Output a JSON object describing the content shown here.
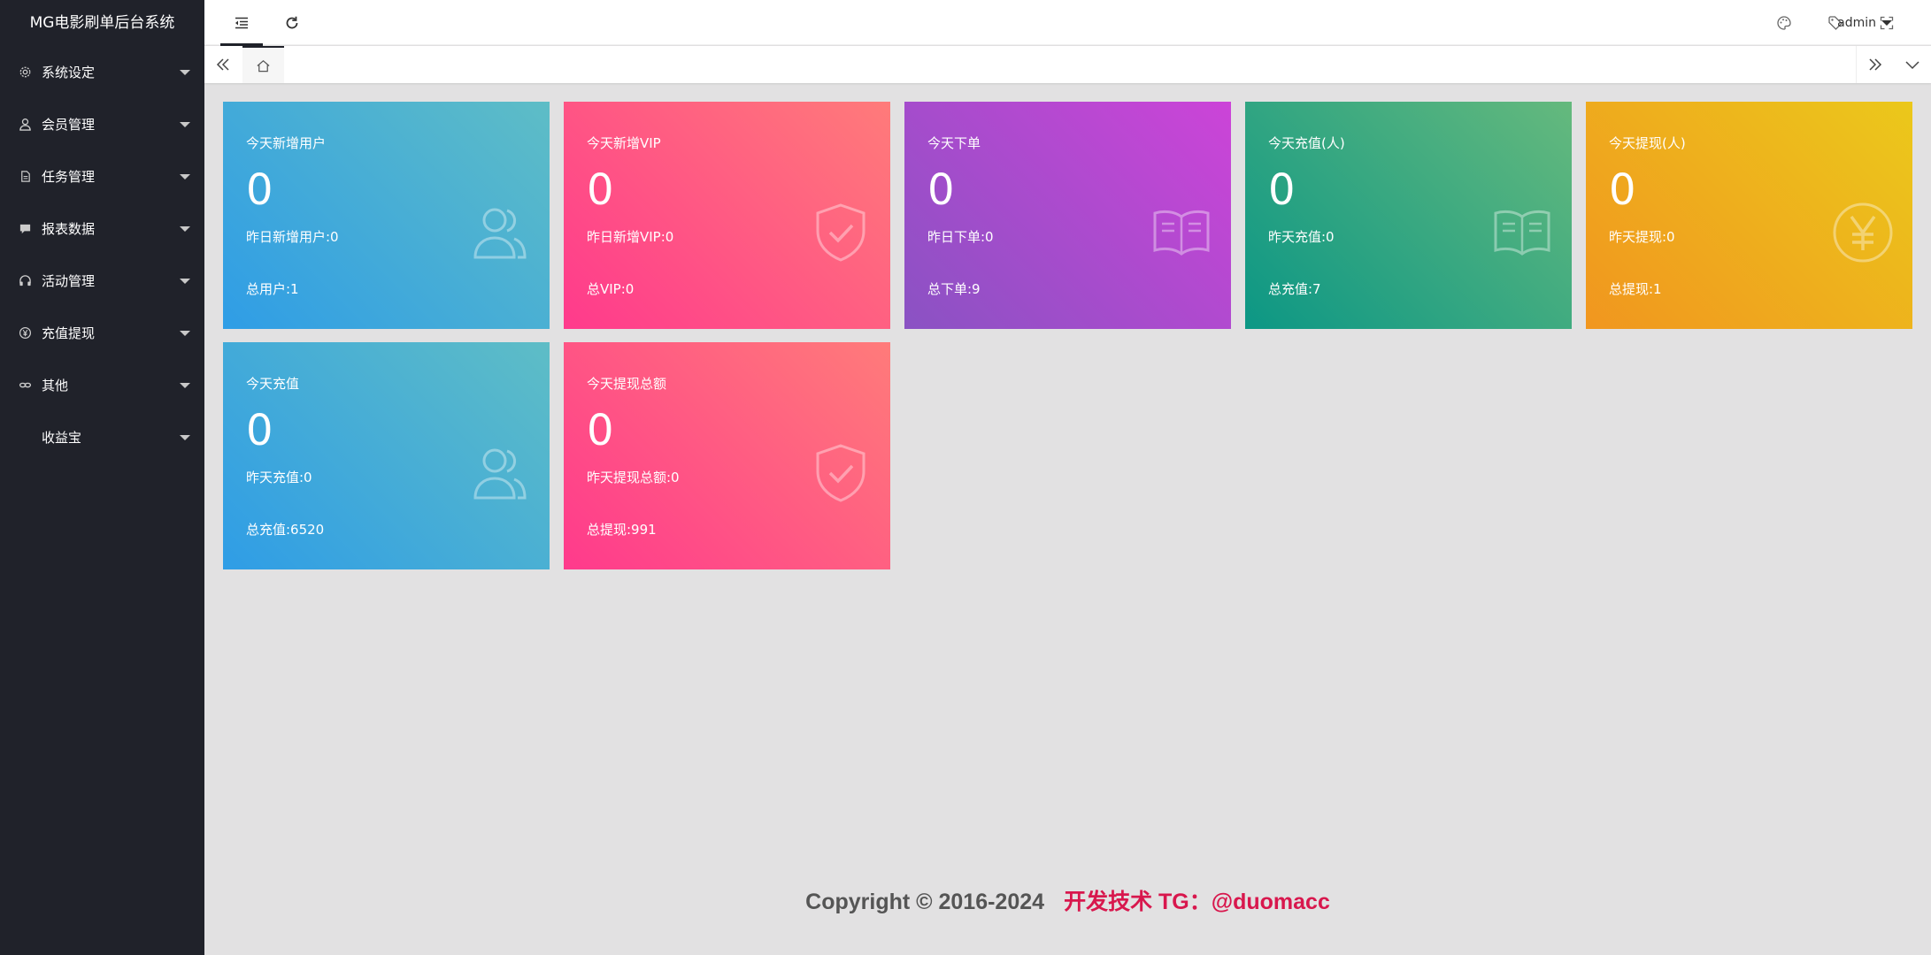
{
  "app": {
    "title": "MG电影刷单后台系统"
  },
  "sidebar": {
    "items": [
      {
        "label": "系统设定",
        "icon": "gear-icon"
      },
      {
        "label": "会员管理",
        "icon": "user-icon"
      },
      {
        "label": "任务管理",
        "icon": "document-icon"
      },
      {
        "label": "报表数据",
        "icon": "chat-icon"
      },
      {
        "label": "活动管理",
        "icon": "headset-icon"
      },
      {
        "label": "充值提现",
        "icon": "yen-circle-icon"
      },
      {
        "label": "其他",
        "icon": "link-icon"
      },
      {
        "label": "收益宝",
        "icon": ""
      }
    ]
  },
  "header": {
    "user": "admin",
    "icons": [
      "menu-collapse-icon",
      "refresh-icon",
      "palette-icon",
      "tag-icon",
      "fullscreen-icon"
    ]
  },
  "cards": [
    {
      "title": "今天新增用户",
      "value": "0",
      "line1": "昨日新增用户:0",
      "line2": "总用户:1",
      "icon": "users-icon",
      "color": "blue"
    },
    {
      "title": "今天新增VIP",
      "value": "0",
      "line1": "昨日新增VIP:0",
      "line2": "总VIP:0",
      "icon": "shield-check-icon",
      "color": "pink"
    },
    {
      "title": "今天下单",
      "value": "0",
      "line1": "昨日下单:0",
      "line2": "总下单:9",
      "icon": "book-icon",
      "color": "purple"
    },
    {
      "title": "今天充值(人)",
      "value": "0",
      "line1": "昨天充值:0",
      "line2": "总充值:7",
      "icon": "book-icon",
      "color": "green"
    },
    {
      "title": "今天提现(人)",
      "value": "0",
      "line1": "昨天提现:0",
      "line2": "总提现:1",
      "icon": "yen-circle-icon",
      "color": "orange"
    },
    {
      "title": "今天充值",
      "value": "0",
      "line1": "昨天充值:0",
      "line2": "总充值:6520",
      "icon": "users-icon",
      "color": "blue"
    },
    {
      "title": "今天提现总额",
      "value": "0",
      "line1": "昨天提现总额:0",
      "line2": "总提现:991",
      "icon": "shield-check-icon",
      "color": "pink"
    }
  ],
  "footer": {
    "copyright": "Copyright © 2016-2024",
    "developer": "开发技术 TG：@duomacc"
  }
}
